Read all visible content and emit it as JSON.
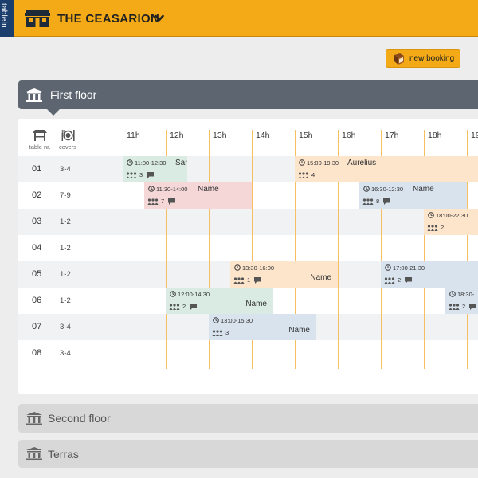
{
  "brand": {
    "label": "tablein"
  },
  "venue": {
    "name": "THE CEASARION"
  },
  "actions": {
    "new_booking": "new booking"
  },
  "floors": {
    "first": "First floor",
    "second": "Second floor",
    "terras": "Terras"
  },
  "columns": {
    "table": "table nr.",
    "covers": "covers"
  },
  "hours": [
    "11h",
    "12h",
    "13h",
    "14h",
    "15h",
    "16h",
    "17h",
    "18h",
    "19"
  ],
  "tables": [
    {
      "nr": "01",
      "covers": "3-4"
    },
    {
      "nr": "02",
      "covers": "7-9"
    },
    {
      "nr": "03",
      "covers": "1-2"
    },
    {
      "nr": "04",
      "covers": "1-2"
    },
    {
      "nr": "05",
      "covers": "1-2"
    },
    {
      "nr": "06",
      "covers": "1-2"
    },
    {
      "nr": "07",
      "covers": "3-4"
    },
    {
      "nr": "08",
      "covers": "3-4"
    }
  ],
  "bookings": [
    {
      "table": "01",
      "time": "11:00-12:30",
      "name": "Santini",
      "guests": "3",
      "message": true,
      "color": "green"
    },
    {
      "table": "01",
      "time": "15:00-19:30",
      "name": "Aurelius",
      "guests": "4",
      "message": false,
      "color": "orange"
    },
    {
      "table": "02",
      "time": "11:30-14:00",
      "name": "Name",
      "guests": "7",
      "message": true,
      "color": "red"
    },
    {
      "table": "02",
      "time": "16:30-12:30",
      "name": "Name",
      "guests": "8",
      "message": true,
      "color": "blue"
    },
    {
      "table": "03",
      "time": "18:00-22:30",
      "name": "",
      "guests": "2",
      "message": false,
      "color": "orange"
    },
    {
      "table": "05",
      "time": "13:30-16:00",
      "name": "Name",
      "guests": "1",
      "message": true,
      "color": "orange"
    },
    {
      "table": "05",
      "time": "17:00-21:30",
      "name": "",
      "guests": "2",
      "message": true,
      "color": "blue"
    },
    {
      "table": "06",
      "time": "12:00-14:30",
      "name": "Name",
      "guests": "2",
      "message": true,
      "color": "green"
    },
    {
      "table": "06",
      "time": "18:30-",
      "name": "",
      "guests": "2",
      "message": true,
      "color": "blue"
    },
    {
      "table": "07",
      "time": "13:00-15:30",
      "name": "Name",
      "guests": "3",
      "message": false,
      "color": "blue"
    }
  ],
  "colors": {
    "accent": "#f3aa16",
    "brand_dark": "#1c3e6d",
    "floor_active": "#5d6670",
    "hour_line": "#f6c060"
  }
}
